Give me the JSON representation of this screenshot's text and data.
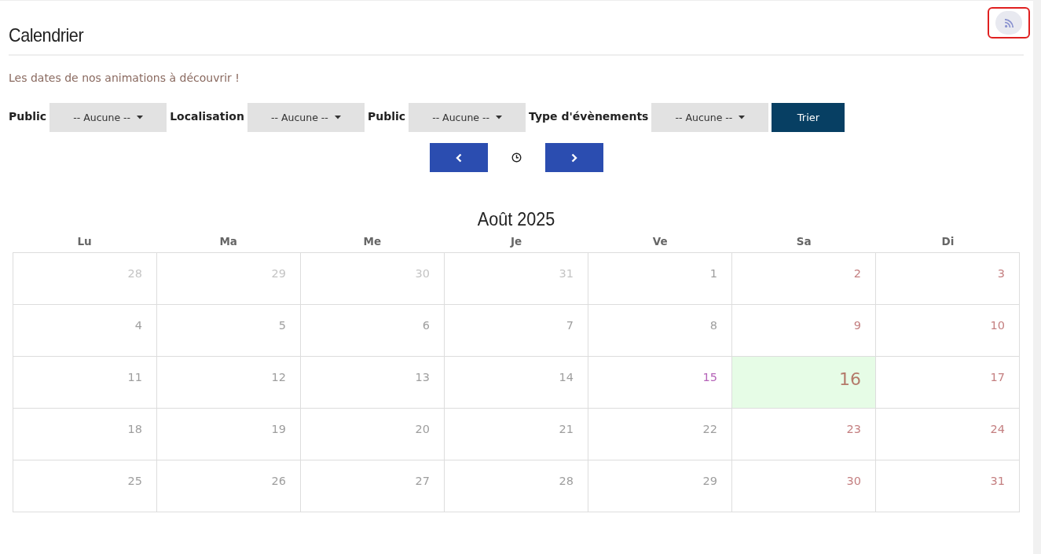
{
  "page": {
    "title": "Calendrier",
    "subtitle": "Les dates de nos animations à découvrir !"
  },
  "filters": [
    {
      "label": "Public",
      "value": "-- Aucune --"
    },
    {
      "label": "Localisation",
      "value": "-- Aucune --"
    },
    {
      "label": "Public",
      "value": "-- Aucune --"
    },
    {
      "label": "Type d'évènements",
      "value": "-- Aucune --"
    }
  ],
  "sort_button": "Trier",
  "calendar": {
    "month": "Août 2025",
    "weekdays": [
      "Lu",
      "Ma",
      "Me",
      "Je",
      "Ve",
      "Sa",
      "Di"
    ],
    "weeks": [
      [
        {
          "day": "28",
          "kind": "other"
        },
        {
          "day": "29",
          "kind": "other"
        },
        {
          "day": "30",
          "kind": "other"
        },
        {
          "day": "31",
          "kind": "other"
        },
        {
          "day": "1",
          "kind": "weekday"
        },
        {
          "day": "2",
          "kind": "weekend"
        },
        {
          "day": "3",
          "kind": "weekend"
        }
      ],
      [
        {
          "day": "4",
          "kind": "weekday"
        },
        {
          "day": "5",
          "kind": "weekday"
        },
        {
          "day": "6",
          "kind": "weekday"
        },
        {
          "day": "7",
          "kind": "weekday"
        },
        {
          "day": "8",
          "kind": "weekday"
        },
        {
          "day": "9",
          "kind": "weekend"
        },
        {
          "day": "10",
          "kind": "weekend"
        }
      ],
      [
        {
          "day": "11",
          "kind": "weekday"
        },
        {
          "day": "12",
          "kind": "weekday"
        },
        {
          "day": "13",
          "kind": "weekday"
        },
        {
          "day": "14",
          "kind": "weekday"
        },
        {
          "day": "15",
          "kind": "holiday"
        },
        {
          "day": "16",
          "kind": "today"
        },
        {
          "day": "17",
          "kind": "weekend"
        }
      ],
      [
        {
          "day": "18",
          "kind": "weekday"
        },
        {
          "day": "19",
          "kind": "weekday"
        },
        {
          "day": "20",
          "kind": "weekday"
        },
        {
          "day": "21",
          "kind": "weekday"
        },
        {
          "day": "22",
          "kind": "weekday"
        },
        {
          "day": "23",
          "kind": "weekend"
        },
        {
          "day": "24",
          "kind": "weekend"
        }
      ],
      [
        {
          "day": "25",
          "kind": "weekday"
        },
        {
          "day": "26",
          "kind": "weekday"
        },
        {
          "day": "27",
          "kind": "weekday"
        },
        {
          "day": "28",
          "kind": "weekday"
        },
        {
          "day": "29",
          "kind": "weekday"
        },
        {
          "day": "30",
          "kind": "weekend"
        },
        {
          "day": "31",
          "kind": "weekend"
        }
      ]
    ]
  }
}
